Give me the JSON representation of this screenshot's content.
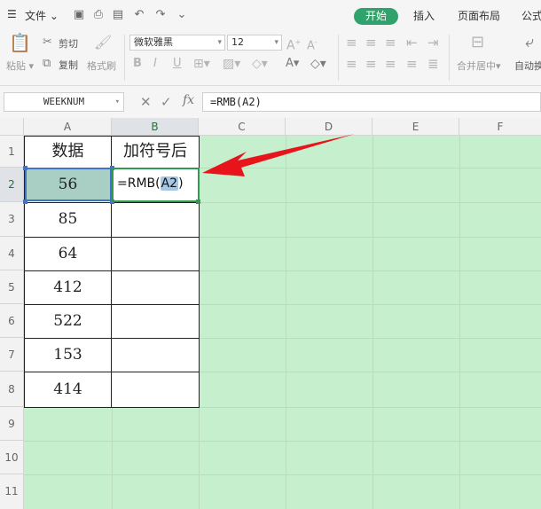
{
  "menu": {
    "file_label": "文件",
    "tab_start": "开始",
    "tab_insert": "插入",
    "tab_page_layout": "页面布局",
    "tab_formula": "公式"
  },
  "ribbon": {
    "paste_label": "粘贴",
    "cut_label": "剪切",
    "copy_label": "复制",
    "format_painter_label": "格式刷",
    "font_name": "微软雅黑",
    "font_size": "12",
    "merge_center_label": "合并居中",
    "auto_wrap_label": "自动换"
  },
  "formula_bar": {
    "name_box": "WEEKNUM",
    "formula": "=RMB(A2)"
  },
  "sheet": {
    "columns": [
      "A",
      "B",
      "C",
      "D",
      "E",
      "F"
    ],
    "rows": [
      "1",
      "2",
      "3",
      "4",
      "5",
      "6",
      "7",
      "8",
      "9",
      "10",
      "11"
    ],
    "header_a": "数据",
    "header_b": "加符号后",
    "data_values": [
      "56",
      "85",
      "64",
      "412",
      "522",
      "153",
      "414"
    ],
    "edit_prefix": "=RMB(",
    "edit_ref": "A2",
    "edit_suffix": ")"
  },
  "colors": {
    "accent_green": "#2fa36b",
    "sheet_bg": "#c6efce",
    "arrow_red": "#e8141b"
  }
}
